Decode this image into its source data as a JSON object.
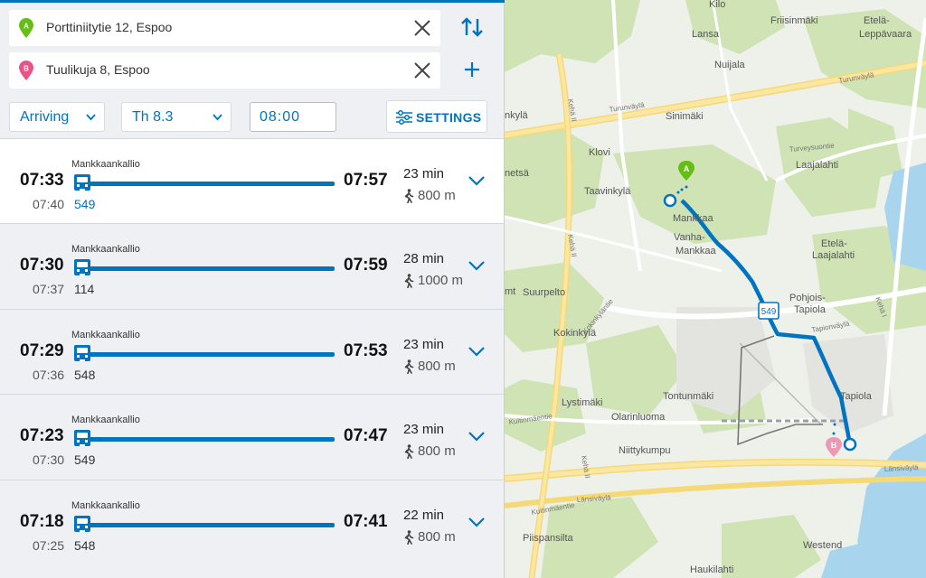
{
  "search": {
    "origin": "Porttiniitytie 12, Espoo",
    "origin_marker": "A",
    "destination": "Tuulikuja 8, Espoo",
    "destination_marker": "B"
  },
  "options": {
    "mode": "Arriving",
    "date": "Th 8.3",
    "time": "08:00",
    "settings_label": "SETTINGS"
  },
  "itineraries": [
    {
      "stop": "Mankkaankallio",
      "depart": "07:33",
      "board": "07:40",
      "route": "549",
      "arrive": "07:57",
      "duration": "23 min",
      "walk": "800 m"
    },
    {
      "stop": "Mankkaankallio",
      "depart": "07:30",
      "board": "07:37",
      "route": "114",
      "arrive": "07:59",
      "duration": "28 min",
      "walk": "1000 m"
    },
    {
      "stop": "Mankkaankallio",
      "depart": "07:29",
      "board": "07:36",
      "route": "548",
      "arrive": "07:53",
      "duration": "23 min",
      "walk": "800 m"
    },
    {
      "stop": "Mankkaankallio",
      "depart": "07:23",
      "board": "07:30",
      "route": "549",
      "arrive": "07:47",
      "duration": "23 min",
      "walk": "800 m"
    },
    {
      "stop": "Mankkaankallio",
      "depart": "07:18",
      "board": "07:25",
      "route": "548",
      "arrive": "07:41",
      "duration": "22 min",
      "walk": "800 m"
    }
  ],
  "map": {
    "places": [
      "Kilo",
      "Friisinmäki",
      "Etelä-",
      "Leppävaara",
      "Lansa",
      "Nuijala",
      "Sinimäki",
      "Klovi",
      "Laajalahti",
      "Taavinkylä",
      "Mankkaa",
      "Vanha-",
      "Mankkaa",
      "Etelä-",
      "Laajalahti",
      "Pohjois-",
      "Tapiola",
      "Suurpelto",
      "Kokinkylä",
      "Tapiola",
      "Lystimäki",
      "Tontunmäki",
      "Olarinluoma",
      "Niittykumpu",
      "Piispansilta",
      "Westend",
      "Haukilahti",
      "nkylä",
      "netsä",
      "mt"
    ],
    "roads": [
      "Turunväylä",
      "Turunväylä",
      "Turveysuontie",
      "Kehä II",
      "Kehä II",
      "Kokinkyläntie",
      "Tapionväylä",
      "Länsiväylä",
      "Länsiväylä",
      "Kehä I",
      "Kuitinmäentie",
      "Kuitinmäentie",
      "Kehä II"
    ],
    "route_badge": "549",
    "marker_a": "A",
    "marker_b": "B"
  },
  "colors": {
    "accent": "#0074bf",
    "origin_pin": "#64be14",
    "destination_pin": "#ec5188",
    "route_line": "#0074bf"
  }
}
